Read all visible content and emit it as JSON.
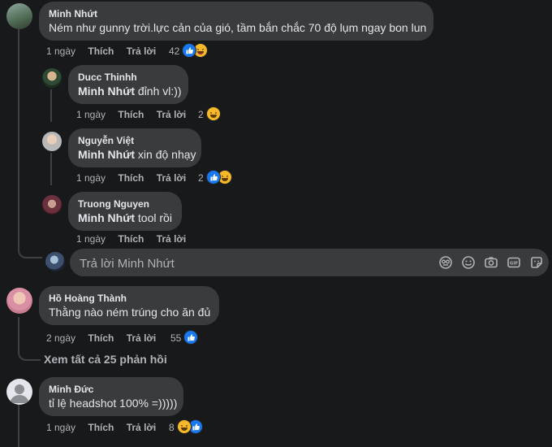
{
  "comments": [
    {
      "name": "Minh Nhứt",
      "text": "Ném như gunny trời.lực cản của gió, tầm bắn chắc 70 độ lụm ngay bon lun",
      "time": "1 ngày",
      "like_label": "Thích",
      "reply_label": "Trả lời",
      "reaction_count": "42",
      "reactions": [
        "like-icon",
        "haha-icon"
      ]
    },
    {
      "name": "Ducc Thinhh",
      "mention": "Minh Nhứt",
      "text": " đỉnh vl:))",
      "time": "1 ngày",
      "like_label": "Thích",
      "reply_label": "Trả lời",
      "reaction_count": "2",
      "reactions": [
        "haha-icon"
      ]
    },
    {
      "name": "Nguyễn Việt",
      "mention": "Minh Nhứt",
      "text": " xin độ nhạy",
      "time": "1 ngày",
      "like_label": "Thích",
      "reply_label": "Trả lời",
      "reaction_count": "2",
      "reactions": [
        "like-icon",
        "haha-icon"
      ]
    },
    {
      "name": "Truong Nguyen",
      "mention": "Minh Nhứt",
      "text": " tool rồi",
      "time": "1 ngày",
      "like_label": "Thích",
      "reply_label": "Trả lời"
    },
    {
      "name": "Hồ Hoàng Thành",
      "text": "Thằng nào ném trúng cho ăn đủ",
      "time": "2 ngày",
      "like_label": "Thích",
      "reply_label": "Trả lời",
      "reaction_count": "55",
      "reactions": [
        "like-icon"
      ]
    },
    {
      "name": "Minh Đức",
      "text": "tỉ lệ headshot 100% =)))))",
      "time": "1 ngày",
      "like_label": "Thích",
      "reply_label": "Trả lời",
      "reaction_count": "8",
      "reactions": [
        "haha-icon",
        "like-icon"
      ]
    }
  ],
  "reply_box": {
    "placeholder": "Trả lời Minh Nhứt",
    "tools": [
      "sticker-face-icon",
      "emoji-icon",
      "camera-icon",
      "gif-icon",
      "sticker-icon"
    ]
  },
  "see_all_replies": "Xem tất cả 25 phản hồi",
  "colors": {
    "background": "#18191a",
    "bubble": "#3a3b3c",
    "like": "#1877f2",
    "haha": "#f7b928"
  }
}
